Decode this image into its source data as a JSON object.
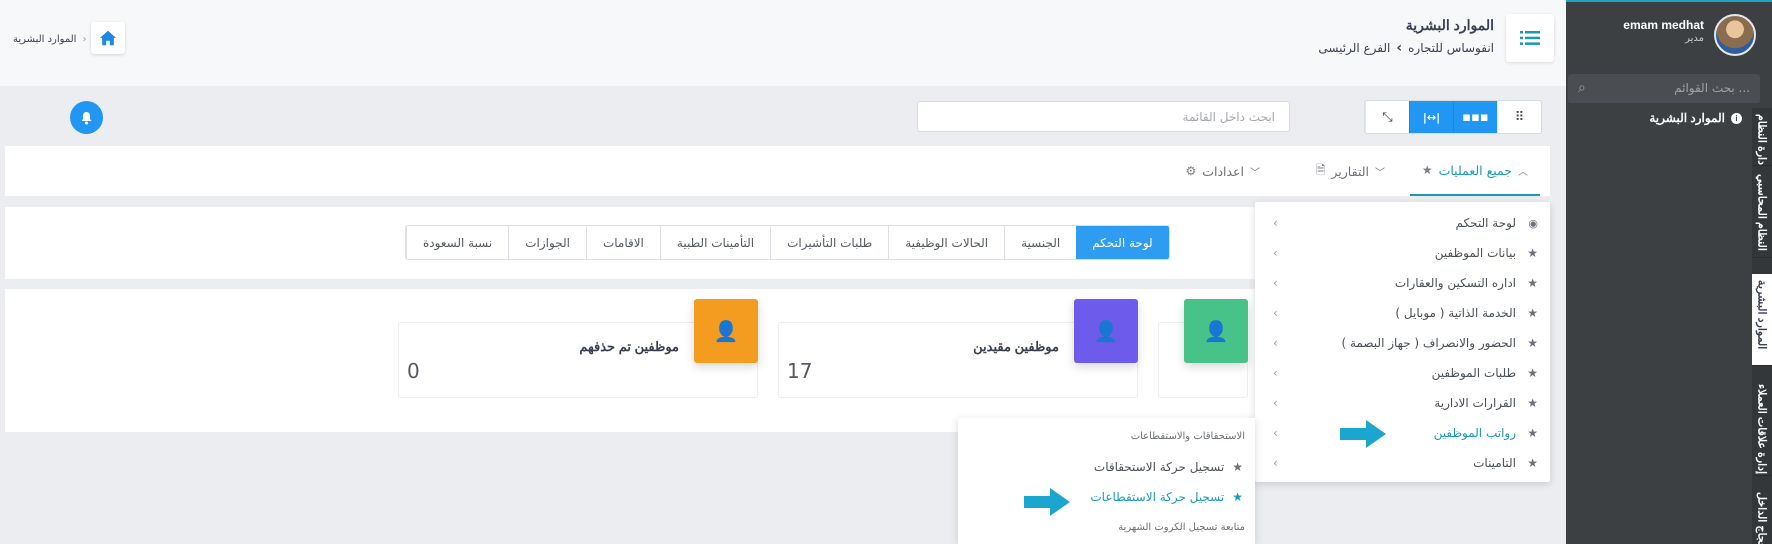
{
  "colors": {
    "accent": "#1b9ab6",
    "primary": "#2196f3",
    "sidebar": "#3c4043",
    "green": "#47c38a",
    "purple": "#6d5ceb",
    "orange": "#f39c1f"
  },
  "sidebar": {
    "user_name": "emam medhat",
    "user_role": "مدير",
    "search_placeholder": "بحث القوائم ...",
    "active_module": "الموارد البشرية",
    "tabs": [
      "دارة النظام",
      "النظام المحاسبي",
      "الموارد البشرية",
      "إدارة علاقات العملاء",
      "حجاج الداخل"
    ]
  },
  "header": {
    "title": "الموارد البشرية",
    "breadcrumb_company": "انفوساس للتجاره",
    "breadcrumb_branch": "الفرع الرئيسى",
    "home_crumb": "الموارد البشرية"
  },
  "toolbar": {
    "search_placeholder": "ابحث داخل القائمة",
    "view_icons": [
      "grid-small-icon",
      "grid-icon",
      "expand-horizontal-icon",
      "compress-icon"
    ]
  },
  "main_tabs": [
    {
      "label": "جميع العمليات",
      "icon": "star-icon",
      "active": true
    },
    {
      "label": "التقارير",
      "icon": "document-icon",
      "active": false
    },
    {
      "label": "اعدادات",
      "icon": "gear-icon",
      "active": false
    }
  ],
  "sub_tabs": [
    "لوحة التحكم",
    "الجنسية",
    "الحالات الوظيفية",
    "طلبات التأشيرات",
    "التأمينات الطبية",
    "الاقامات",
    "الجوازات",
    "نسبة السعودة"
  ],
  "cards": [
    {
      "label": "موظفين مقيدين",
      "value": "17",
      "color": "#6d5ceb"
    },
    {
      "label": "موظفين تم حذفهم",
      "value": "0",
      "color": "#f39c1f"
    }
  ],
  "dropdown": {
    "items": [
      {
        "label": "لوحة التحكم",
        "icon": "dashboard-icon"
      },
      {
        "label": "بيانات الموظفين",
        "icon": "star-icon"
      },
      {
        "label": "اداره التسكين والعقارات",
        "icon": "star-icon"
      },
      {
        "label": "الخدمة الذاتية ( موبايل )",
        "icon": "star-icon"
      },
      {
        "label": "الحضور والانصراف ( جهاز البصمة )",
        "icon": "star-icon"
      },
      {
        "label": "طلبات الموظفين",
        "icon": "star-icon"
      },
      {
        "label": "القرارات الادارية",
        "icon": "star-icon"
      },
      {
        "label": "رواتب الموظفين",
        "icon": "star-icon",
        "highlighted": true
      },
      {
        "label": "التامينات",
        "icon": "star-icon"
      }
    ]
  },
  "submenu": {
    "heading": "الاستحقاقات والاستقطاعات",
    "items": [
      {
        "label": "تسجيل حركة الاستحقاقات"
      },
      {
        "label": "تسجيل حركة الاستقطاعات",
        "highlighted": true
      }
    ],
    "heading2": "متابعة تسجيل الكروت الشهرية"
  }
}
